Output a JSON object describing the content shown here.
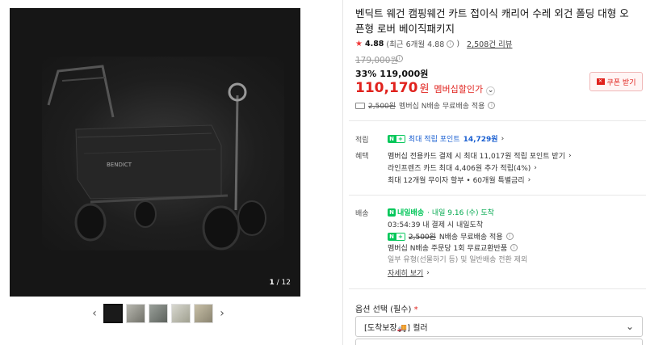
{
  "gallery": {
    "counter_current": "1",
    "counter_total": "/ 12",
    "thumbnail_count": 5
  },
  "product": {
    "title": "벤딕트 웨건 캠핑웨건 카트 접이식 캐리어 수레 외건 폴딩 대형 오픈형 로버 베이직패키지",
    "rating": "4.88",
    "rating_detail": "(최근 6개월 4.88",
    "rating_close": ")",
    "review_count": "2,508건 리뷰",
    "original_price": "179,000원",
    "discount_pct": "33%",
    "discount_price": "119,000원",
    "final_price": "110,170",
    "final_won": "원",
    "member_label": "멤버십할인가",
    "coupon_label": "쿠폰 받기"
  },
  "shipping_summary": {
    "old_fee": "2,500원",
    "text": "멤버십 N배송 무료배송 적용"
  },
  "points": {
    "label": "적립",
    "badge": "최대 적립 포인트",
    "amount": "14,729원"
  },
  "benefits": {
    "label": "혜택",
    "lines": [
      "멤버십 전용카드 결제 시 최대 11,017원 적립 포인트 받기",
      "라인프렌즈 카드 최대 4,406원 추가 적립(4%)",
      "최대 12개월 무이자 할부 • 60개월 특별금리"
    ]
  },
  "delivery": {
    "label": "배송",
    "badge": "내일배송",
    "date": "· 내일 9.16 (수) 도착",
    "countdown": "03:54:39  내 결제 시 내일도착",
    "fee_old": "2,500원",
    "fee_text": "N배송 무료배송 적용",
    "exchange": "멤버십 N배송 주문당 1회 무료교환반품",
    "exclude": "일부 유형(선물하기 등) 및 일반배송 전환 제외",
    "detail_link": "자세히 보기"
  },
  "options": {
    "label": "옵션 선택 (필수)",
    "required_mark": "*",
    "selected": "[도착보장🚚] 컬러"
  },
  "colors": {
    "accent_red": "#e0221d",
    "naver_green": "#03c75a",
    "point_blue": "#1a5fd1"
  }
}
